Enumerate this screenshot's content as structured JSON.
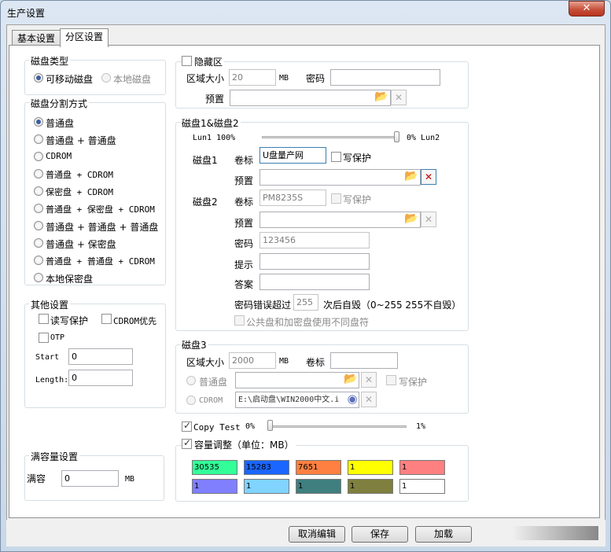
{
  "window": {
    "title": "生产设置",
    "close_glyph": "✕"
  },
  "tabs": [
    {
      "label": "基本设置"
    },
    {
      "label": "分区设置"
    }
  ],
  "disk_type": {
    "label": "磁盘类型",
    "options": [
      {
        "label": "可移动磁盘",
        "selected": true
      },
      {
        "label": "本地磁盘",
        "selected": false,
        "disabled": true
      }
    ]
  },
  "partition_mode": {
    "label": "磁盘分割方式",
    "options": [
      {
        "label": "普通盘",
        "selected": true
      },
      {
        "label": "普通盘 + 普通盘"
      },
      {
        "label": "CDROM"
      },
      {
        "label": "普通盘 + CDROM"
      },
      {
        "label": "保密盘 + CDROM"
      },
      {
        "label": "普通盘 + 保密盘 + CDROM"
      },
      {
        "label": "普通盘 + 普通盘 + 普通盘"
      },
      {
        "label": "普通盘 + 保密盘"
      },
      {
        "label": "普通盘 + 普通盘 + CDROM"
      },
      {
        "label": "本地保密盘"
      }
    ]
  },
  "other": {
    "label": "其他设置",
    "read_write_protect": "读写保护",
    "cdrom_priority": "CDROM优先",
    "otp": "OTP",
    "start_label": "Start",
    "start_value": "0",
    "length_label": "Length:",
    "length_value": "0"
  },
  "full_capacity": {
    "label": "满容量设置",
    "field_label": "满容",
    "value": "0",
    "unit": "MB"
  },
  "hidden": {
    "label": "隐藏区",
    "area_size_label": "区域大小",
    "area_size_value": "20",
    "unit": "MB",
    "password_label": "密码",
    "password_value": "",
    "preset_label": "预置",
    "preset_value": ""
  },
  "disk12": {
    "label": "磁盘1&磁盘2",
    "lun1": "Lun1 100%",
    "lun2": "0% Lun2",
    "lun_split_fraction": 1.0,
    "disk1_label": "磁盘1",
    "volume_label": "卷标",
    "disk1_volume": "U盘量产网",
    "write_protect": "写保护",
    "preset_label": "预置",
    "disk1_preset": "",
    "disk2_label": "磁盘2",
    "disk2_volume": "PM8235S",
    "disk2_preset": "",
    "password_label": "密码",
    "password_value": "123456",
    "hint_label": "提示",
    "hint_value": "",
    "answer_label": "答案",
    "answer_value": "",
    "pwd_error_label": "密码错误超过",
    "pwd_error_value": "255",
    "pwd_error_suffix": "次后自毁（0~255 255不自毁）",
    "public_enc": "公共盘和加密盘使用不同盘符"
  },
  "disk3": {
    "label": "磁盘3",
    "area_size_label": "区域大小",
    "area_size_value": "2000",
    "unit": "MB",
    "volume_label": "卷标",
    "volume_value": "",
    "normal_label": "普通盘",
    "normal_value": "",
    "write_protect": "写保护",
    "cdrom_label": "CDROM",
    "cdrom_value": "E:\\启动盘\\WIN2000中文.i"
  },
  "copy_test": {
    "label": "Copy Test",
    "left": "0%",
    "right": "1%",
    "fraction": 0.0
  },
  "capacity": {
    "label": "容量调整（单位：MB）",
    "cells": [
      {
        "value": "30535",
        "color": "#33ff99"
      },
      {
        "value": "15283",
        "color": "#1a66ff"
      },
      {
        "value": "7651",
        "color": "#ff8040"
      },
      {
        "value": "1",
        "color": "#ffff00"
      },
      {
        "value": "1",
        "color": "#ff8080"
      },
      {
        "value": "1",
        "color": "#8080ff"
      },
      {
        "value": "1",
        "color": "#80d4ff"
      },
      {
        "value": "1",
        "color": "#3f7f7f"
      },
      {
        "value": "1",
        "color": "#7f7f3f"
      },
      {
        "value": "1",
        "color": "#ffffff"
      }
    ]
  },
  "buttons": {
    "cancel": "取消编辑",
    "save": "保存",
    "load": "加载"
  }
}
